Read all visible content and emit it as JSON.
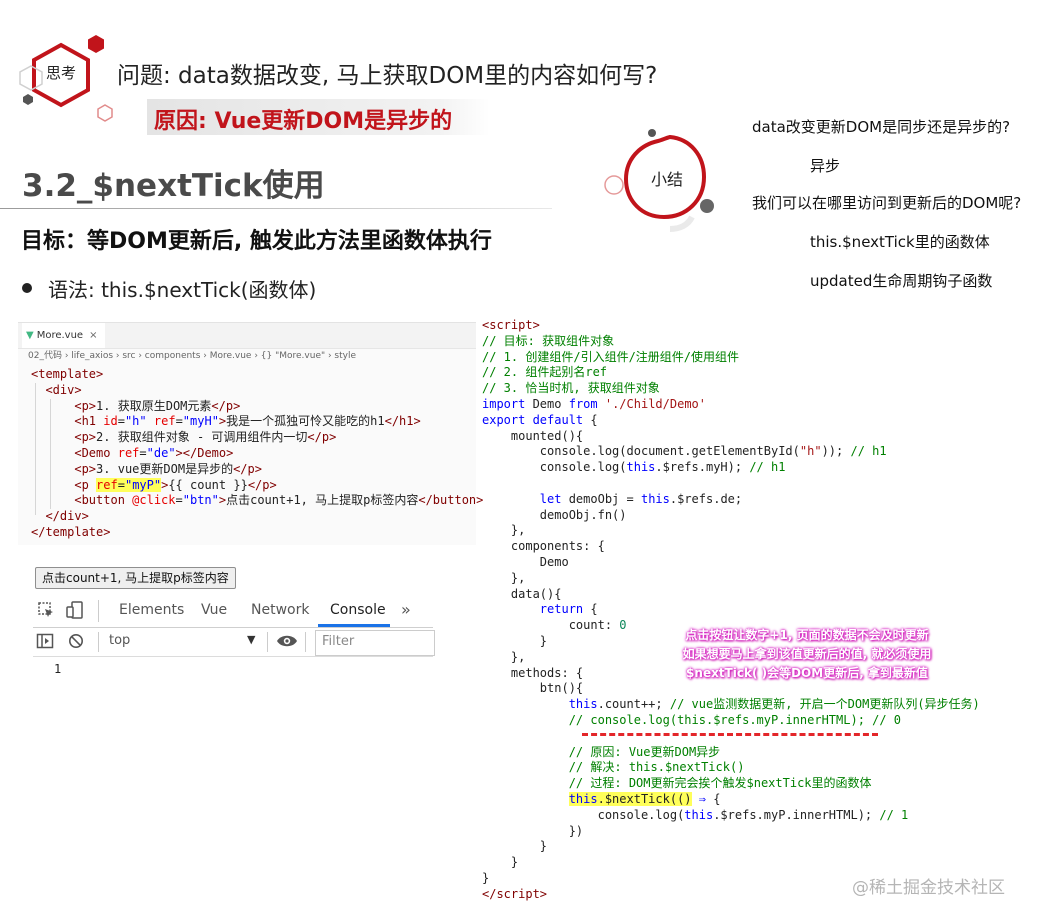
{
  "header": {
    "think_label": "思考",
    "question": "问题: data数据改变, 马上获取DOM里的内容如何写?",
    "reason": "原因: Vue更新DOM是异步的"
  },
  "section": {
    "title": "3.2_$nextTick使用",
    "goal": "目标：等DOM更新后, 触发此方法里函数体执行",
    "syntax": "语法: this.$nextTick(函数体)"
  },
  "summary": {
    "title": "小结",
    "lines": [
      "data改变更新DOM是同步还是异步的?",
      "异步",
      "我们可以在哪里访问到更新后的DOM呢?",
      "this.$nextTick里的函数体",
      "updated生命周期钩子函数"
    ]
  },
  "editor": {
    "tab_label": "More.vue",
    "breadcrumb": "02_代码 › life_axios › src › components › More.vue › {} \"More.vue\" › style",
    "button_label": "点击count+1, 马上提取p标签内容"
  },
  "devtools": {
    "tabs": [
      "Elements",
      "Vue",
      "Network",
      "Console"
    ],
    "active_tab": "Console",
    "more": "»",
    "context": "top",
    "filter_placeholder": "Filter",
    "log_value": "1"
  },
  "note": {
    "line1": "点击按钮让数字+1, 页面的数据不会及时更新",
    "line2": "如果想要马上拿到该值更新后的值, 就必须使用",
    "line3": "$nextTick( )会等DOM更新后, 拿到最新值"
  },
  "watermark": "@稀土掘金技术社区",
  "colors": {
    "accent_red": "#c1141b",
    "note_magenta": "#d61fc5",
    "code_comment": "#008000",
    "code_keyword": "#0000ff"
  }
}
